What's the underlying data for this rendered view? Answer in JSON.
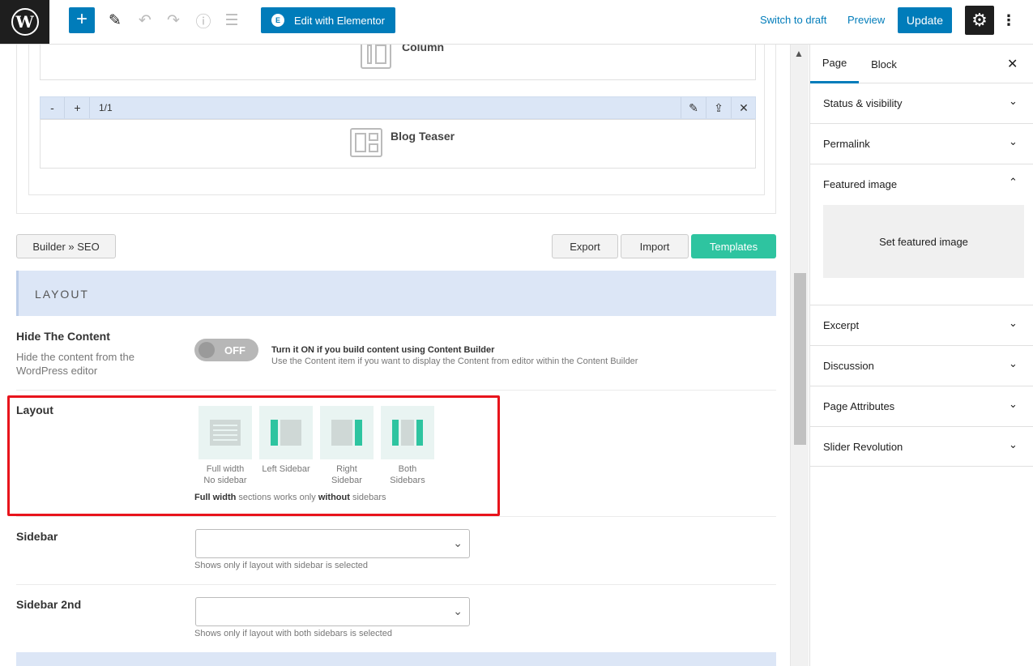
{
  "toolbar": {
    "wp_logo": "W",
    "add": "+",
    "edit_pen": "✎",
    "undo": "↶",
    "redo": "↷",
    "info": "ⓘ",
    "outline": "☰",
    "elementor_icon": "E",
    "elementor_label": "Edit with Elementor",
    "switch_draft": "Switch to draft",
    "preview": "Preview",
    "update": "Update",
    "gear": "⚙",
    "more": "⋮"
  },
  "builder": {
    "column_label": "Column",
    "item_minus": "-",
    "item_plus": "+",
    "item_fraction": "1/1",
    "item_edit": "✎",
    "item_clone": "⇪",
    "item_delete": "✕",
    "blog_label": "Blog Teaser",
    "seo_button": "Builder » SEO",
    "export": "Export",
    "import": "Import",
    "templates": "Templates"
  },
  "layout_section": {
    "title": "LAYOUT",
    "hide_content_label": "Hide The Content",
    "hide_content_desc": "Hide the content from the WordPress editor",
    "toggle_text": "OFF",
    "toggle_hint_bold": "Turn it ON if you build content using Content Builder",
    "toggle_hint": "Use the Content item if you want to display the Content from editor within the Content Builder",
    "layout_label": "Layout",
    "options": [
      {
        "line1": "Full width",
        "line2": "No sidebar"
      },
      {
        "line1": "Left Sidebar",
        "line2": ""
      },
      {
        "line1": "Right",
        "line2": "Sidebar"
      },
      {
        "line1": "Both",
        "line2": "Sidebars"
      }
    ],
    "note_b1": "Full width",
    "note_t1": " sections works only ",
    "note_b2": "without",
    "note_t2": " sidebars",
    "sidebar_label": "Sidebar",
    "sidebar_hint": "Shows only if layout with sidebar is selected",
    "sidebar2_label": "Sidebar 2nd",
    "sidebar2_hint": "Shows only if layout with both sidebars is selected",
    "chevron": "⌄"
  },
  "scroll": {
    "up": "▲"
  },
  "sidebar": {
    "tab_page": "Page",
    "tab_block": "Block",
    "close": "✕",
    "panels": [
      {
        "title": "Status & visibility",
        "chevron": "⌄"
      },
      {
        "title": "Permalink",
        "chevron": "⌄"
      },
      {
        "title": "Featured image",
        "chevron": "⌃"
      },
      {
        "title": "Excerpt",
        "chevron": "⌄"
      },
      {
        "title": "Discussion",
        "chevron": "⌄"
      },
      {
        "title": "Page Attributes",
        "chevron": "⌄"
      },
      {
        "title": "Slider Revolution",
        "chevron": "⌄"
      }
    ],
    "set_featured": "Set featured image"
  },
  "colors": {
    "accent": "#007cba",
    "green": "#2ec4a0",
    "highlight": "#e8141c"
  }
}
